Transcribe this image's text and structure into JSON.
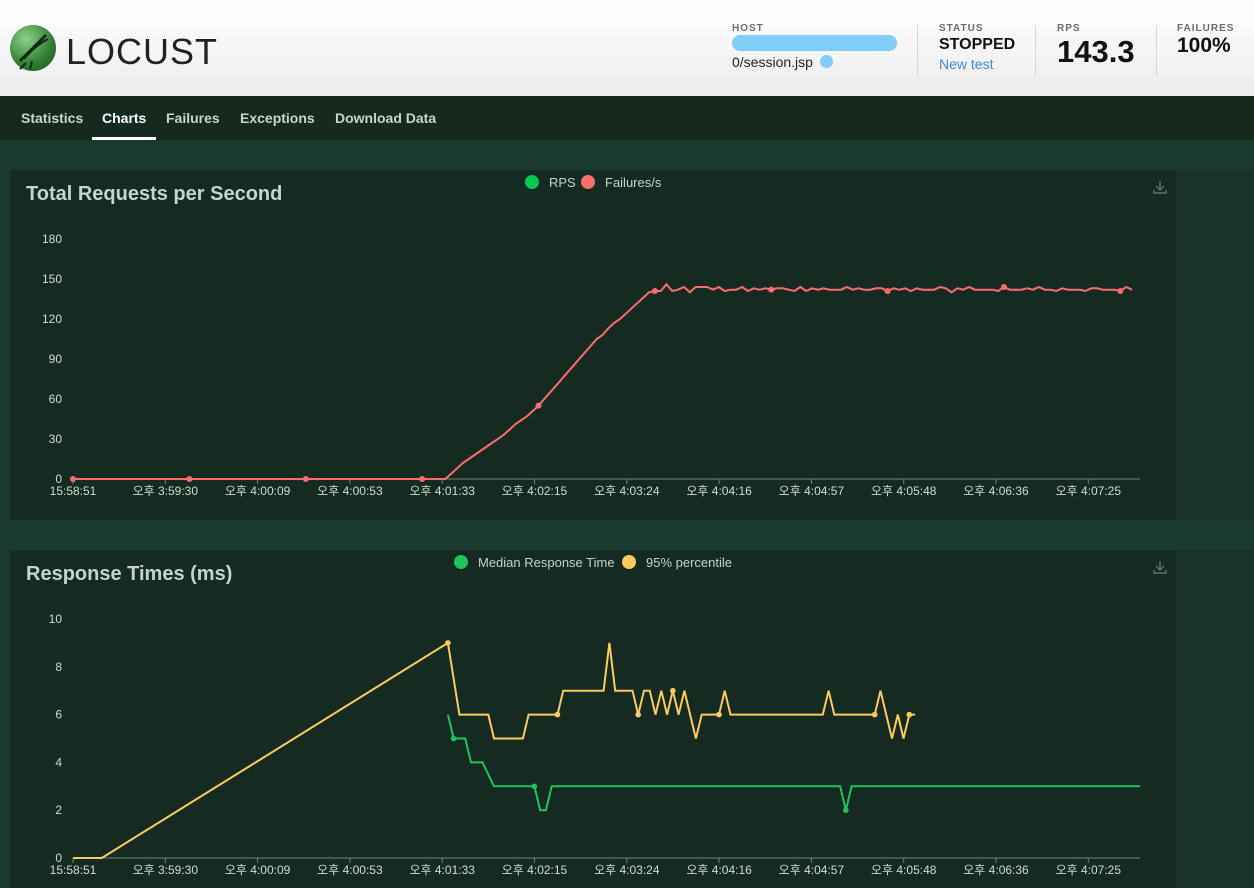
{
  "header": {
    "logo_text": "LOCUST",
    "host": {
      "label": "HOST",
      "url": "0/session.jsp"
    },
    "status": {
      "label": "STATUS",
      "value": "STOPPED",
      "new_test_label": "New test"
    },
    "rps": {
      "label": "RPS",
      "value": "143.3"
    },
    "failures": {
      "label": "FAILURES",
      "value": "100%"
    }
  },
  "nav": {
    "tabs": [
      {
        "label": "Statistics",
        "active": false
      },
      {
        "label": "Charts",
        "active": true
      },
      {
        "label": "Failures",
        "active": false
      },
      {
        "label": "Exceptions",
        "active": false
      },
      {
        "label": "Download Data",
        "active": false
      }
    ]
  },
  "colors": {
    "rps": "#00c853",
    "failures": "#ff6d6d",
    "median": "#1ec45a",
    "p95": "#ffca5f",
    "grid": "#5e7468"
  },
  "chart_data": [
    {
      "type": "line",
      "title": "Total Requests per Second",
      "legend": [
        "RPS",
        "Failures/s"
      ],
      "x_ticks": [
        "15:58:51",
        "오후 3:59:30",
        "오후 4:00:09",
        "오후 4:00:53",
        "오후 4:01:33",
        "오후 4:02:15",
        "오후 4:03:24",
        "오후 4:04:16",
        "오후 4:04:57",
        "오후 4:05:48",
        "오후 4:06:36",
        "오후 4:07:25"
      ],
      "ylim": [
        0,
        180
      ],
      "y_ticks": [
        0,
        30,
        60,
        90,
        120,
        150,
        180
      ],
      "n_points": 131,
      "series": [
        {
          "name": "Failures/s",
          "values": [
            0,
            0,
            0,
            0,
            0,
            0,
            0,
            0,
            0,
            0,
            0,
            0,
            0,
            0,
            0,
            0,
            0,
            0,
            0,
            0,
            0,
            0,
            0,
            0,
            0,
            0,
            0,
            0,
            0,
            0,
            0,
            0,
            0,
            0,
            0,
            0,
            0,
            0,
            0,
            0,
            0,
            0,
            0,
            0,
            0,
            0,
            0,
            0,
            0,
            0,
            0,
            0,
            0,
            0,
            0,
            0,
            0,
            0,
            0,
            0,
            0,
            0,
            0,
            0,
            0,
            4,
            8,
            12,
            15,
            18,
            21,
            24,
            27,
            30,
            33,
            37,
            41,
            44,
            47,
            51,
            55,
            60,
            65,
            70,
            75,
            80,
            85,
            90,
            95,
            100,
            105,
            108,
            113,
            117,
            120,
            124,
            128,
            132,
            136,
            140,
            141,
            141,
            146,
            141,
            142,
            144,
            140,
            144,
            144,
            144,
            142,
            144,
            141,
            142,
            142,
            144,
            141,
            143,
            142,
            143,
            142,
            143,
            143,
            142,
            141,
            144,
            141,
            143,
            142,
            143,
            142,
            142,
            142,
            144,
            142,
            143,
            142,
            142,
            143,
            143,
            141,
            143,
            142,
            143,
            141,
            143,
            142,
            142,
            142,
            144,
            143,
            140,
            143,
            142,
            144,
            142,
            142,
            142,
            142,
            141,
            144,
            142,
            142,
            142,
            143,
            142,
            144,
            142,
            142,
            141,
            143,
            142,
            142,
            142,
            141,
            143,
            143,
            142,
            142,
            142,
            141,
            144,
            142
          ]
        }
      ]
    },
    {
      "type": "line",
      "title": "Response Times (ms)",
      "legend": [
        "Median Response Time",
        "95% percentile"
      ],
      "x_ticks": [
        "15:58:51",
        "오후 3:59:30",
        "오후 4:00:09",
        "오후 4:00:53",
        "오후 4:01:33",
        "오후 4:02:15",
        "오후 4:03:24",
        "오후 4:04:16",
        "오후 4:04:57",
        "오후 4:05:48",
        "오후 4:06:36",
        "오후 4:07:25"
      ],
      "ylim": [
        0,
        10
      ],
      "y_ticks": [
        0,
        2,
        4,
        6,
        8,
        10
      ],
      "series": [
        {
          "name": "Median Response Time",
          "points": [
            [
              0,
              null
            ],
            [
              65,
              6
            ],
            [
              66,
              5
            ],
            [
              68,
              5
            ],
            [
              69,
              4
            ],
            [
              71,
              4
            ],
            [
              73,
              3
            ],
            [
              77,
              3
            ],
            [
              80,
              3
            ],
            [
              81,
              2
            ],
            [
              82,
              2
            ],
            [
              83,
              3
            ],
            [
              130,
              3
            ],
            [
              133,
              3
            ],
            [
              134,
              2
            ],
            [
              135,
              3
            ],
            [
              185,
              3
            ]
          ]
        },
        {
          "name": "95% percentile",
          "points": [
            [
              0,
              0
            ],
            [
              5,
              0
            ],
            [
              65,
              9
            ],
            [
              67,
              6
            ],
            [
              72,
              6
            ],
            [
              73,
              5
            ],
            [
              78,
              5
            ],
            [
              79,
              6
            ],
            [
              84,
              6
            ],
            [
              85,
              7
            ],
            [
              92,
              7
            ],
            [
              93,
              9
            ],
            [
              94,
              7
            ],
            [
              97,
              7
            ],
            [
              98,
              6
            ],
            [
              99,
              7
            ],
            [
              100,
              7
            ],
            [
              101,
              6
            ],
            [
              102,
              7
            ],
            [
              103,
              6
            ],
            [
              104,
              7
            ],
            [
              105,
              6
            ],
            [
              106,
              7
            ],
            [
              107,
              6
            ],
            [
              108,
              5
            ],
            [
              109,
              6
            ],
            [
              112,
              6
            ],
            [
              113,
              7
            ],
            [
              114,
              6
            ],
            [
              130,
              6
            ],
            [
              131,
              7
            ],
            [
              132,
              6
            ],
            [
              139,
              6
            ],
            [
              140,
              7
            ],
            [
              141,
              6
            ],
            [
              142,
              5
            ],
            [
              143,
              6
            ],
            [
              144,
              5
            ],
            [
              145,
              6
            ],
            [
              146,
              6
            ]
          ]
        }
      ]
    }
  ]
}
